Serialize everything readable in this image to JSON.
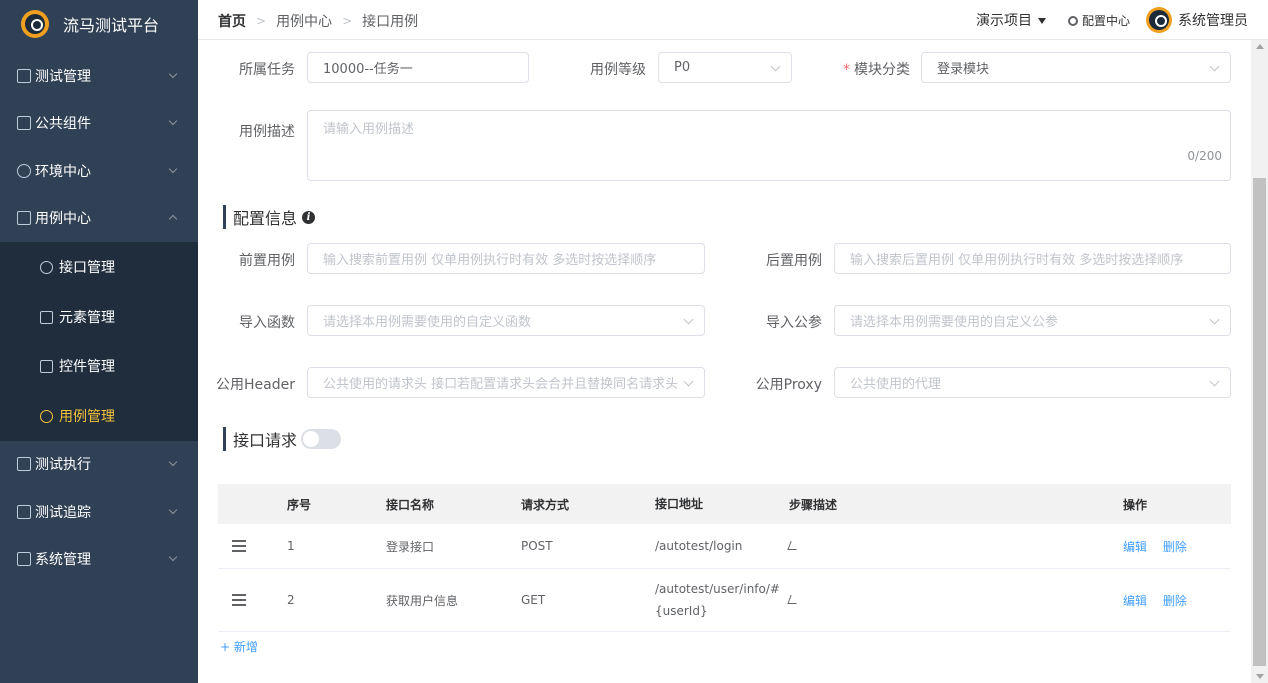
{
  "brand": {
    "title": "流马测试平台"
  },
  "sidebar": {
    "items": [
      {
        "label": "测试管理"
      },
      {
        "label": "公共组件"
      },
      {
        "label": "环境中心"
      },
      {
        "label": "用例中心"
      },
      {
        "label": "测试执行"
      },
      {
        "label": "测试追踪"
      },
      {
        "label": "系统管理"
      }
    ],
    "subitems": [
      {
        "label": "接口管理"
      },
      {
        "label": "元素管理"
      },
      {
        "label": "控件管理"
      },
      {
        "label": "用例管理"
      }
    ],
    "active_color": "#f4c33b",
    "bg_color": "#304156"
  },
  "header": {
    "breadcrumb": [
      "首页",
      "用例中心",
      "接口用例"
    ],
    "project": "演示项目",
    "config": "配置中心",
    "user": "系统管理员"
  },
  "form": {
    "task_label": "所属任务",
    "task_value": "10000--任务一",
    "level_label": "用例等级",
    "level_value": "P0",
    "module_label": "模块分类",
    "module_required": "*",
    "module_value": "登录模块",
    "desc_label": "用例描述",
    "desc_placeholder": "请输入用例描述",
    "desc_count": "0/200"
  },
  "config_section": {
    "title": "配置信息",
    "pre_label": "前置用例",
    "pre_placeholder": "输入搜索前置用例 仅单用例执行时有效 多选时按选择顺序",
    "post_label": "后置用例",
    "post_placeholder": "输入搜索后置用例 仅单用例执行时有效 多选时按选择顺序",
    "func_label": "导入函数",
    "func_placeholder": "请选择本用例需要使用的自定义函数",
    "param_label": "导入公参",
    "param_placeholder": "请选择本用例需要使用的自定义公参",
    "header_label": "公用Header",
    "header_placeholder": "公共使用的请求头 接口若配置请求头会合并且替换同名请求头",
    "proxy_label": "公用Proxy",
    "proxy_placeholder": "公共使用的代理"
  },
  "api_section": {
    "title": "接口请求",
    "switch_on": false
  },
  "table": {
    "headers": {
      "no": "序号",
      "name": "接口名称",
      "method": "请求方式",
      "url": "接口地址",
      "desc": "步骤描述",
      "op": "操作"
    },
    "rows": [
      {
        "no": "1",
        "name": "登录接口",
        "method": "POST",
        "url": "/autotest/login",
        "edit": "编辑",
        "delete": "删除"
      },
      {
        "no": "2",
        "name": "获取用户信息",
        "method": "GET",
        "url": "/autotest/user/info/#{userId}",
        "edit": "编辑",
        "delete": "删除"
      }
    ],
    "add_label": "+ 新增"
  }
}
